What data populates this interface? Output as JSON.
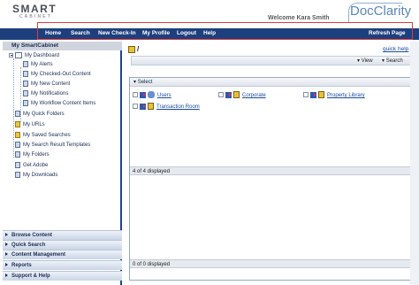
{
  "header": {
    "logo_line1": "SMART",
    "logo_line2": "CABINET",
    "welcome": "Welcome Kara Smith",
    "brand": "DocClarity"
  },
  "nav": {
    "items": [
      "Home",
      "Search",
      "New Check-In",
      "My Profile",
      "Logout",
      "Help"
    ],
    "right": "Refresh Page"
  },
  "sidebar": {
    "title": "My SmartCabinet",
    "dashboard": "My Dashboard",
    "dashboard_children": [
      "My Alerts",
      "My Checked-Out Content",
      "My New Content",
      "My Notifications",
      "My Workflow Content Items"
    ],
    "items": [
      "My Quick Folders",
      "My URLs",
      "My Saved Searches",
      "My Search Result Templates",
      "My Folders",
      "Get Adobe",
      "My Downloads"
    ],
    "accordions": [
      "Browse Content",
      "Quick Search",
      "Content Management",
      "Reports",
      "Support & Help"
    ]
  },
  "main": {
    "breadcrumb": "/",
    "quick_help": "quick help",
    "view_label": "View",
    "search_label": "Search",
    "select_label": "Select",
    "cabinets": [
      "Users",
      "Corporate",
      "Property Library",
      "Transaction Room"
    ],
    "upper_count": "4 of 4 displayed",
    "lower_count": "0 of 0 displayed"
  },
  "colors": {
    "nav_bg": "#1d3f7d",
    "highlight": "#e03a3a",
    "link": "#1a4aa0"
  }
}
